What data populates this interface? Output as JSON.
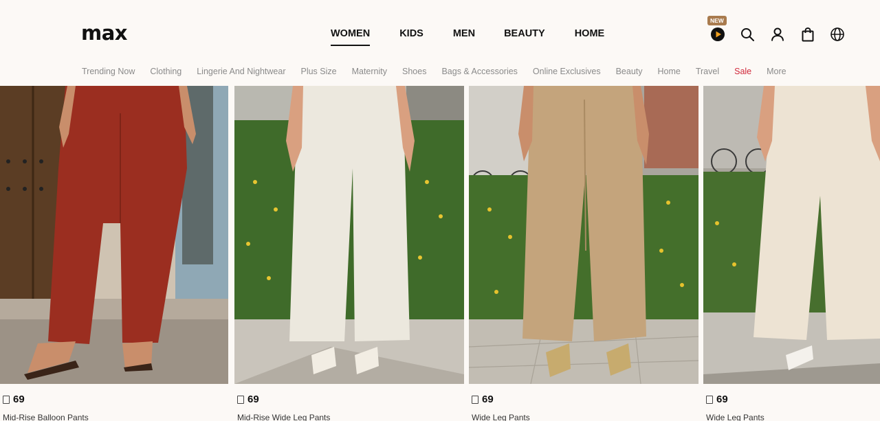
{
  "brand": {
    "logo_text": "max"
  },
  "main_nav": {
    "items": [
      {
        "label": "WOMEN",
        "active": true
      },
      {
        "label": "KIDS"
      },
      {
        "label": "MEN"
      },
      {
        "label": "BEAUTY"
      },
      {
        "label": "HOME"
      }
    ]
  },
  "header_icons": {
    "badge": "NEW",
    "items": [
      "play-video-icon",
      "search-icon",
      "user-icon",
      "shopping-bag-icon",
      "globe-icon"
    ]
  },
  "sub_nav": {
    "items": [
      {
        "label": "Trending Now"
      },
      {
        "label": "Clothing"
      },
      {
        "label": "Lingerie And Nightwear"
      },
      {
        "label": "Plus Size"
      },
      {
        "label": "Maternity"
      },
      {
        "label": "Shoes"
      },
      {
        "label": "Bags & Accessories"
      },
      {
        "label": "Online Exclusives"
      },
      {
        "label": "Beauty"
      },
      {
        "label": "Home"
      },
      {
        "label": "Travel"
      },
      {
        "label": "Sale",
        "highlight": "#d0283a"
      },
      {
        "label": "More"
      }
    ]
  },
  "products": [
    {
      "price": "69",
      "name": "Mid-Rise Balloon Pants",
      "pants_color": "#9b2e20"
    },
    {
      "price": "69",
      "name": "Mid-Rise Wide Leg Pants",
      "pants_color": "#ece8de"
    },
    {
      "price": "69",
      "name": "Wide Leg Pants",
      "pants_color": "#c4a47c"
    },
    {
      "price": "69",
      "name": "Wide Leg Pants",
      "pants_color": "#ede3d3"
    }
  ],
  "colors": {
    "background": "#fcf9f6",
    "sale": "#d0283a",
    "badge": "#a97b4e"
  }
}
